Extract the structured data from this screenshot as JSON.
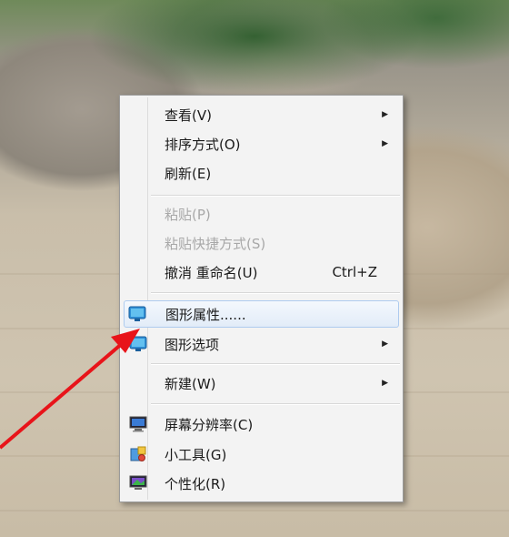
{
  "menu": {
    "items": [
      {
        "label": "查看(V)",
        "submenu": true
      },
      {
        "label": "排序方式(O)",
        "submenu": true
      },
      {
        "label": "刷新(E)"
      },
      {
        "label": "粘贴(P)",
        "disabled": true
      },
      {
        "label": "粘贴快捷方式(S)",
        "disabled": true
      },
      {
        "label": "撤消 重命名(U)",
        "shortcut": "Ctrl+Z"
      },
      {
        "label": "图形属性......",
        "icon": "graphics-properties-icon",
        "highlighted": true
      },
      {
        "label": "图形选项",
        "icon": "graphics-options-icon",
        "submenu": true
      },
      {
        "label": "新建(W)",
        "submenu": true
      },
      {
        "label": "屏幕分辨率(C)",
        "icon": "screen-resolution-icon"
      },
      {
        "label": "小工具(G)",
        "icon": "gadgets-icon"
      },
      {
        "label": "个性化(R)",
        "icon": "personalize-icon"
      }
    ],
    "submenu_arrow": "▶"
  },
  "annotation": {
    "color": "#e8141a"
  }
}
